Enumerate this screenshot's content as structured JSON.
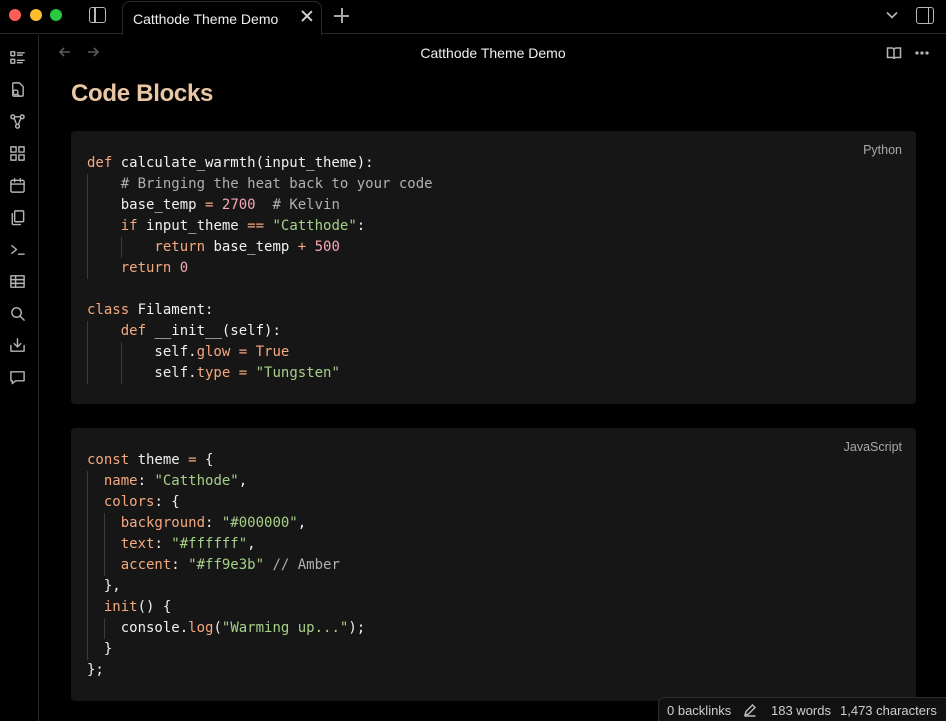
{
  "window": {
    "tab_title": "Catthode Theme Demo",
    "view_title": "Catthode Theme Demo"
  },
  "ribbon": {
    "icons": [
      "outline-icon",
      "files-icon",
      "graph-icon",
      "blocks-icon",
      "calendar-icon",
      "copy-icon",
      "terminal-icon",
      "table-icon",
      "search-icon",
      "import-icon",
      "comment-icon"
    ]
  },
  "content": {
    "heading": "Code Blocks",
    "blocks": [
      {
        "language": "Python",
        "lines": [
          [
            [
              "kw",
              "def "
            ],
            [
              "fn",
              "calculate_warmth(input_theme):"
            ]
          ],
          [
            [
              "cmt",
              "    # Bringing the heat back to your code"
            ]
          ],
          [
            [
              "fn",
              "    base_temp "
            ],
            [
              "op",
              "="
            ],
            [
              "fn",
              " "
            ],
            [
              "num",
              "2700"
            ],
            [
              "cmt",
              "  # Kelvin"
            ]
          ],
          [
            [
              "kw",
              "    if "
            ],
            [
              "fn",
              "input_theme "
            ],
            [
              "op",
              "=="
            ],
            [
              "fn",
              " "
            ],
            [
              "str",
              "\"Catthode\""
            ],
            [
              "fn",
              ":"
            ]
          ],
          [
            [
              "kw",
              "        return "
            ],
            [
              "fn",
              "base_temp "
            ],
            [
              "op",
              "+"
            ],
            [
              "fn",
              " "
            ],
            [
              "num",
              "500"
            ]
          ],
          [
            [
              "kw",
              "    return "
            ],
            [
              "num",
              "0"
            ]
          ],
          [
            [
              "fn",
              ""
            ]
          ],
          [
            [
              "kw",
              "class "
            ],
            [
              "fn",
              "Filament:"
            ]
          ],
          [
            [
              "kw",
              "    def "
            ],
            [
              "fn",
              "__init__(self):"
            ]
          ],
          [
            [
              "fn",
              "        self."
            ],
            [
              "attr",
              "glow"
            ],
            [
              "fn",
              " "
            ],
            [
              "op",
              "="
            ],
            [
              "fn",
              " "
            ],
            [
              "kw",
              "True"
            ]
          ],
          [
            [
              "fn",
              "        self."
            ],
            [
              "attr",
              "type"
            ],
            [
              "fn",
              " "
            ],
            [
              "op",
              "="
            ],
            [
              "fn",
              " "
            ],
            [
              "str",
              "\"Tungsten\""
            ]
          ]
        ]
      },
      {
        "language": "JavaScript",
        "lines": [
          [
            [
              "kw",
              "const "
            ],
            [
              "fn",
              "theme "
            ],
            [
              "op",
              "="
            ],
            [
              "fn",
              " {"
            ]
          ],
          [
            [
              "prop",
              "  name"
            ],
            [
              "fn",
              ": "
            ],
            [
              "str",
              "\"Catthode\""
            ],
            [
              "fn",
              ","
            ]
          ],
          [
            [
              "prop",
              "  colors"
            ],
            [
              "fn",
              ": {"
            ]
          ],
          [
            [
              "prop",
              "    background"
            ],
            [
              "fn",
              ": "
            ],
            [
              "str",
              "\"#000000\""
            ],
            [
              "fn",
              ","
            ]
          ],
          [
            [
              "prop",
              "    text"
            ],
            [
              "fn",
              ": "
            ],
            [
              "str",
              "\"#ffffff\""
            ],
            [
              "fn",
              ","
            ]
          ],
          [
            [
              "prop",
              "    accent"
            ],
            [
              "fn",
              ": "
            ],
            [
              "str",
              "\"#ff9e3b\""
            ],
            [
              "cmt",
              " // Amber"
            ]
          ],
          [
            [
              "fn",
              "  },"
            ]
          ],
          [
            [
              "prop",
              "  init"
            ],
            [
              "fn",
              "() {"
            ]
          ],
          [
            [
              "fn",
              "    console."
            ],
            [
              "attr",
              "log"
            ],
            [
              "fn",
              "("
            ],
            [
              "str",
              "\"Warming up...\""
            ],
            [
              "fn",
              ");"
            ]
          ],
          [
            [
              "fn",
              "  }"
            ]
          ],
          [
            [
              "fn",
              "};"
            ]
          ]
        ]
      }
    ]
  },
  "status": {
    "backlinks": "0 backlinks",
    "words": "183 words",
    "characters": "1,473 characters"
  },
  "colors": {
    "heading": "#e9c7a4",
    "keyword": "#f5a97f",
    "string": "#a6d189",
    "number": "#f7a8b8",
    "comment": "#b0b0b0",
    "code_bg": "#161616"
  }
}
